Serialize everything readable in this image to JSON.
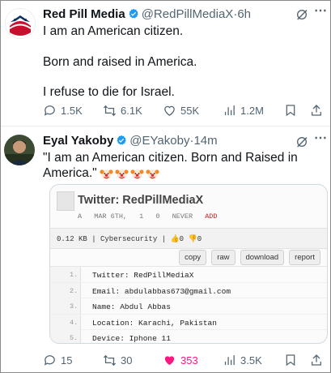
{
  "tweet1": {
    "name": "Red Pill Media",
    "handle": "@RedPillMediaX",
    "time": "6h",
    "lines": [
      "I am an American citizen.",
      "Born and raised in America.",
      "I refuse to die for Israel."
    ],
    "actions": {
      "replies": "1.5K",
      "reposts": "6.1K",
      "likes": "55K",
      "views": "1.2M"
    }
  },
  "tweet2": {
    "name": "Eyal Yakoby",
    "handle": "@EYakoby",
    "time": "14m",
    "text_line1": "\"I am an American citizen. Born and Raised in",
    "text_line2": "America.\"",
    "emojis": [
      "clown-face",
      "clown-face",
      "clown-face",
      "clown-face"
    ],
    "card": {
      "title": "Twitter: RedPillMediaX",
      "meta": [
        "A",
        "MAR 6TH,",
        "1",
        "0",
        "NEVER",
        "ADD"
      ],
      "info": "0.12 KB | Cybersecurity |",
      "votes_up": "0",
      "votes_down": "0",
      "tools": [
        "copy",
        "raw",
        "download",
        "report"
      ],
      "lines": [
        {
          "n": "1.",
          "text": "Twitter: RedPillMediaX"
        },
        {
          "n": "2.",
          "text": "Email: abdulabbas673@gmail.com"
        },
        {
          "n": "3.",
          "text": "Name: Abdul Abbas"
        },
        {
          "n": "4.",
          "text": "Location: Karachi, Pakistan"
        },
        {
          "n": "5.",
          "text": "Device: Iphone 11"
        }
      ]
    },
    "actions": {
      "replies": "15",
      "reposts": "30",
      "likes": "353",
      "views": "3.5K"
    }
  },
  "colors": {
    "verified": "#1d9bf0",
    "like": "#f91880",
    "muted": "#536471"
  }
}
